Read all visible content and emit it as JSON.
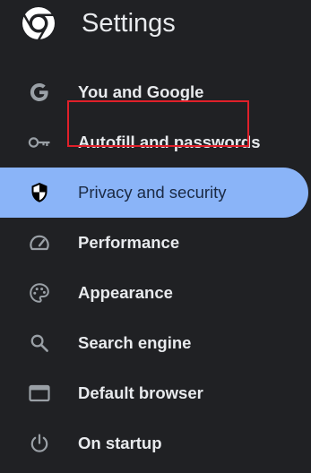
{
  "header": {
    "app_icon": "chrome-logo-icon",
    "title": "Settings"
  },
  "sidebar": {
    "items": [
      {
        "label": "You and Google",
        "icon": "google-g-icon",
        "active": false
      },
      {
        "label": "Autofill and passwords",
        "icon": "key-icon",
        "active": false
      },
      {
        "label": "Privacy and security",
        "icon": "shield-icon",
        "active": true
      },
      {
        "label": "Performance",
        "icon": "speedometer-icon",
        "active": false
      },
      {
        "label": "Appearance",
        "icon": "palette-icon",
        "active": false
      },
      {
        "label": "Search engine",
        "icon": "search-icon",
        "active": false
      },
      {
        "label": "Default browser",
        "icon": "browser-window-icon",
        "active": false
      },
      {
        "label": "On startup",
        "icon": "power-icon",
        "active": false
      }
    ]
  },
  "colors": {
    "background": "#202124",
    "text": "#e8eaed",
    "icon": "#9aa0a6",
    "active_background": "#8ab4f8",
    "active_text": "#1b2a44",
    "highlight_border": "#e0202a"
  }
}
